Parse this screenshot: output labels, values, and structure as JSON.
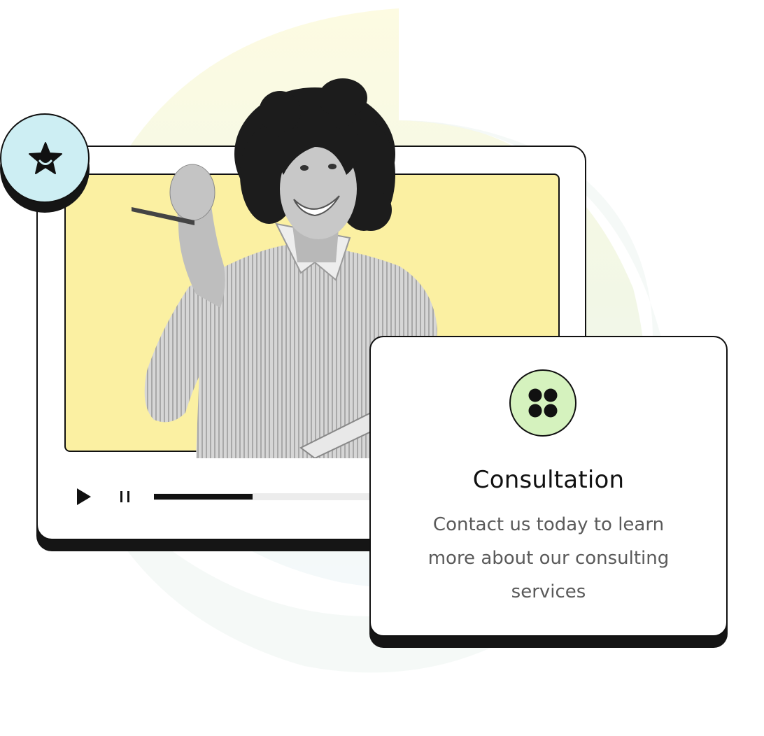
{
  "colors": {
    "video_background": "#FBF0A2",
    "badge_background": "#CDEEF3",
    "card_icon_background": "#D5F2BE",
    "blob_yellow": "#FDFBE4",
    "blob_green": "#F0F6E6",
    "blob_blue": "#F1F8FB",
    "outline": "#111111"
  },
  "player": {
    "progress": 0.44,
    "icons": {
      "play": "play-icon",
      "pause": "pause-icon",
      "badge": "star-smile-icon"
    }
  },
  "card": {
    "icon": "four-dots-icon",
    "title": "Consultation",
    "description": "Contact us today to learn more about our consulting services"
  }
}
